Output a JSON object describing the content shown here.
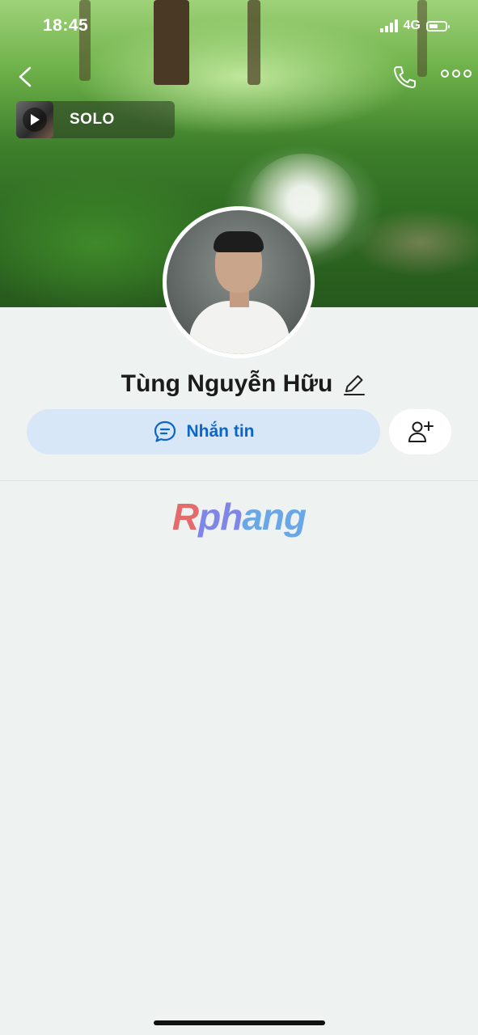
{
  "status_bar": {
    "time": "18:45",
    "network": "4G"
  },
  "nav": {
    "back_icon": "chevron-left-icon",
    "call_icon": "phone-icon",
    "more_icon": "more-horizontal-icon"
  },
  "music": {
    "title": "SOLO",
    "play_icon": "play-icon"
  },
  "profile": {
    "name": "Tùng Nguyễn Hữu",
    "edit_icon": "pencil-icon"
  },
  "actions": {
    "message_label": "Nhắn tin",
    "message_icon": "chat-bubble-icon",
    "add_friend_icon": "add-user-icon"
  },
  "watermark": {
    "part_a": "R",
    "part_b": "ph",
    "part_c": "ang"
  },
  "colors": {
    "accent": "#0b66c9",
    "button_bg": "#d7e7f8",
    "page_bg": "#eef2f1"
  }
}
